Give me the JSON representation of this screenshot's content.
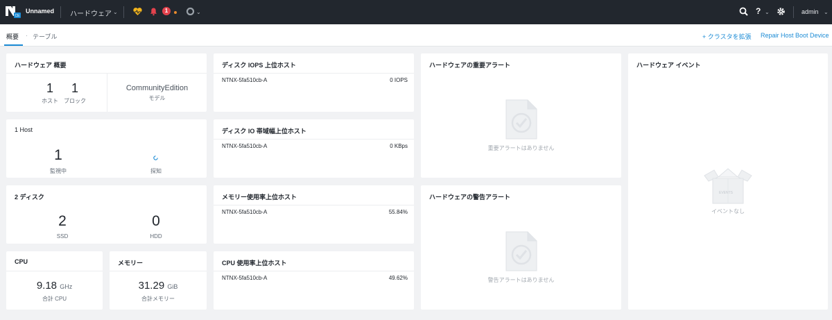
{
  "topbar": {
    "cluster_name": "Unnamed",
    "menu_label": "ハードウェア",
    "alert_count": "1",
    "user": "admin"
  },
  "subbar": {
    "tab_overview": "概要",
    "tab_table": "テーブル",
    "expand_cluster": "+ クラスタを拡張",
    "repair": "Repair Host Boot Device"
  },
  "summary": {
    "title": "ハードウェア 概要",
    "hosts_value": "1",
    "hosts_label": "ホスト",
    "blocks_value": "1",
    "blocks_label": "ブロック",
    "model_value": "CommunityEdition",
    "model_label": "モデル"
  },
  "host": {
    "title": "1 Host",
    "monitored_value": "1",
    "monitored_label": "監視中",
    "discovered_label": "探知"
  },
  "disk": {
    "title": "2 ディスク",
    "ssd_value": "2",
    "ssd_label": "SSD",
    "hdd_value": "0",
    "hdd_label": "HDD"
  },
  "cpu": {
    "title": "CPU",
    "value": "9.18",
    "unit": "GHz",
    "label": "合計 CPU"
  },
  "memory": {
    "title": "メモリー",
    "value": "31.29",
    "unit": "GiB",
    "label": "合計メモリー"
  },
  "iops": {
    "title": "ディスク IOPS 上位ホスト",
    "host": "NTNX-5fa510cb-A",
    "value": "0 IOPS"
  },
  "bandwidth": {
    "title": "ディスク IO 帯域幅上位ホスト",
    "host": "NTNX-5fa510cb-A",
    "value": "0 KBps"
  },
  "mem_usage": {
    "title": "メモリー使用率上位ホスト",
    "host": "NTNX-5fa510cb-A",
    "value": "55.84%"
  },
  "cpu_usage": {
    "title": "CPU 使用率上位ホスト",
    "host": "NTNX-5fa510cb-A",
    "value": "49.62%"
  },
  "critical": {
    "title": "ハードウェアの重要アラート",
    "empty": "重要アラートはありません"
  },
  "warning": {
    "title": "ハードウェアの警告アラート",
    "empty": "警告アラートはありません"
  },
  "events": {
    "title": "ハードウェア イベント",
    "empty": "イベントなし",
    "box_text": "EVENTS"
  },
  "colors": {
    "topbar": "#22272e",
    "accent": "#1b8bd5",
    "alert": "#e3424d",
    "health": "#f2b41c"
  }
}
